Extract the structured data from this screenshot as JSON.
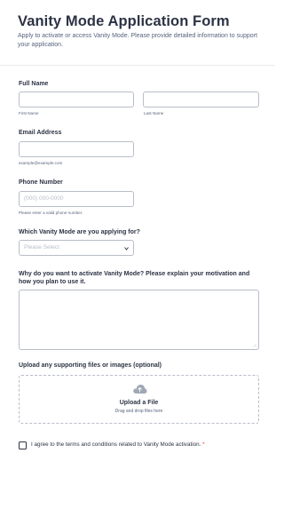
{
  "form": {
    "title": "Vanity Mode Application Form",
    "subtitle": "Apply to activate or access Vanity Mode. Please provide detailed information to support your application."
  },
  "full_name": {
    "label": "Full Name",
    "first_sub": "First Name",
    "last_sub": "Last Name",
    "first_value": "",
    "last_value": ""
  },
  "email": {
    "label": "Email Address",
    "sub": "example@example.com",
    "value": ""
  },
  "phone": {
    "label": "Phone Number",
    "placeholder": "(000) 000-0000",
    "sub": "Please enter a valid phone number."
  },
  "mode_select": {
    "label": "Which Vanity Mode are you applying for?",
    "selected": "Please Select"
  },
  "motivation": {
    "label": "Why do you want to activate Vanity Mode? Please explain your motivation and how you plan to use it.",
    "value": ""
  },
  "upload": {
    "label": "Upload any supporting files or images (optional)",
    "title": "Upload a File",
    "sub": "Drag and drop files here",
    "icon": "cloud-upload-icon"
  },
  "terms": {
    "label": "I agree to the terms and conditions related to Vanity Mode activation.",
    "required_mark": "*"
  },
  "colors": {
    "text": "#2c3345",
    "muted": "#57647e",
    "border": "#b8bdc9",
    "required": "#f23a3c",
    "icon": "#a0a7b5"
  }
}
